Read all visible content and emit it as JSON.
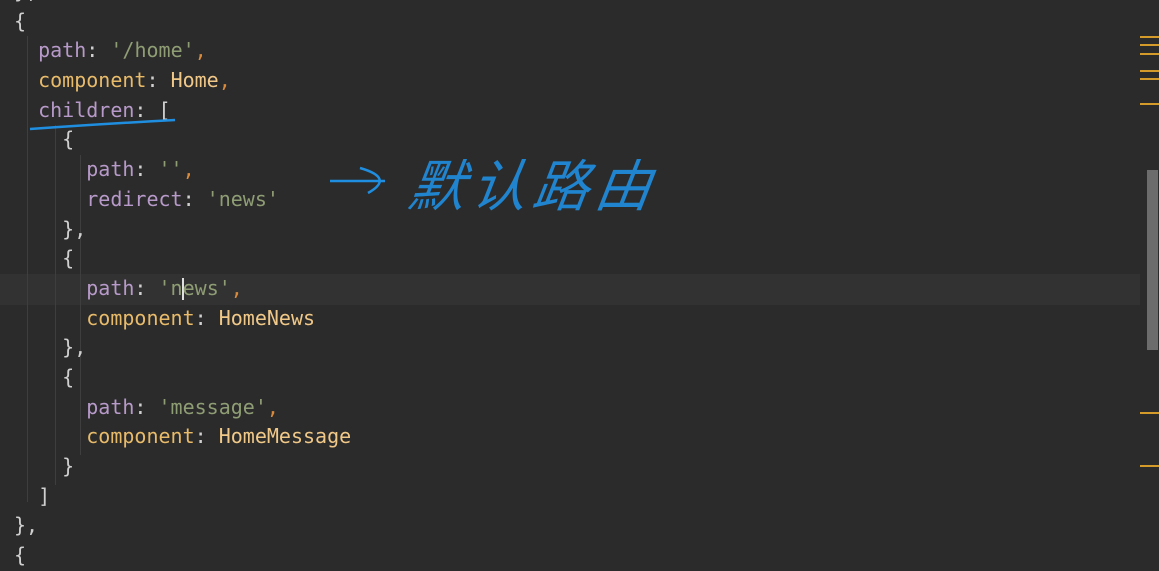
{
  "code_lines": [
    {
      "indent": "",
      "parts": [
        {
          "t": "},",
          "c": "p"
        }
      ]
    },
    {
      "indent": "",
      "parts": [
        {
          "t": "{",
          "c": "p"
        }
      ]
    },
    {
      "indent": "  ",
      "parts": [
        {
          "t": "path",
          "c": "k"
        },
        {
          "t": ": ",
          "c": "p"
        },
        {
          "t": "'/home'",
          "c": "s"
        },
        {
          "t": ",",
          "c": "o"
        }
      ]
    },
    {
      "indent": "  ",
      "parts": [
        {
          "t": "component",
          "c": "c"
        },
        {
          "t": ": ",
          "c": "p"
        },
        {
          "t": "Home",
          "c": "v"
        },
        {
          "t": ",",
          "c": "o"
        }
      ]
    },
    {
      "indent": "  ",
      "parts": [
        {
          "t": "children",
          "c": "k"
        },
        {
          "t": ": [",
          "c": "p"
        }
      ]
    },
    {
      "indent": "    ",
      "parts": [
        {
          "t": "{",
          "c": "p"
        }
      ]
    },
    {
      "indent": "      ",
      "parts": [
        {
          "t": "path",
          "c": "k"
        },
        {
          "t": ": ",
          "c": "p"
        },
        {
          "t": "''",
          "c": "s"
        },
        {
          "t": ",",
          "c": "o"
        }
      ]
    },
    {
      "indent": "      ",
      "parts": [
        {
          "t": "redirect",
          "c": "k"
        },
        {
          "t": ": ",
          "c": "p"
        },
        {
          "t": "'news'",
          "c": "s"
        }
      ]
    },
    {
      "indent": "    ",
      "parts": [
        {
          "t": "},",
          "c": "p"
        }
      ]
    },
    {
      "indent": "    ",
      "parts": [
        {
          "t": "{",
          "c": "p"
        }
      ]
    },
    {
      "indent": "      ",
      "parts": [
        {
          "t": "path",
          "c": "k"
        },
        {
          "t": ": ",
          "c": "p"
        },
        {
          "t": "'n",
          "c": "s"
        },
        {
          "t": "|",
          "c": "cursor"
        },
        {
          "t": "ews'",
          "c": "s"
        },
        {
          "t": ",",
          "c": "o"
        }
      ]
    },
    {
      "indent": "      ",
      "parts": [
        {
          "t": "component",
          "c": "c"
        },
        {
          "t": ": ",
          "c": "p"
        },
        {
          "t": "HomeNews",
          "c": "v"
        }
      ]
    },
    {
      "indent": "    ",
      "parts": [
        {
          "t": "},",
          "c": "p"
        }
      ]
    },
    {
      "indent": "    ",
      "parts": [
        {
          "t": "{",
          "c": "p"
        }
      ]
    },
    {
      "indent": "      ",
      "parts": [
        {
          "t": "path",
          "c": "k"
        },
        {
          "t": ": ",
          "c": "p"
        },
        {
          "t": "'message'",
          "c": "s"
        },
        {
          "t": ",",
          "c": "o"
        }
      ]
    },
    {
      "indent": "      ",
      "parts": [
        {
          "t": "component",
          "c": "c"
        },
        {
          "t": ": ",
          "c": "p"
        },
        {
          "t": "HomeMessage",
          "c": "v"
        }
      ]
    },
    {
      "indent": "    ",
      "parts": [
        {
          "t": "}",
          "c": "p"
        }
      ]
    },
    {
      "indent": "  ",
      "parts": [
        {
          "t": "]",
          "c": "p"
        }
      ]
    },
    {
      "indent": "",
      "parts": [
        {
          "t": "},",
          "c": "p"
        }
      ]
    },
    {
      "indent": "",
      "parts": [
        {
          "t": "{",
          "c": "p"
        }
      ]
    }
  ],
  "annotation": {
    "text": "默认路由",
    "color": "#1f8ee0"
  }
}
